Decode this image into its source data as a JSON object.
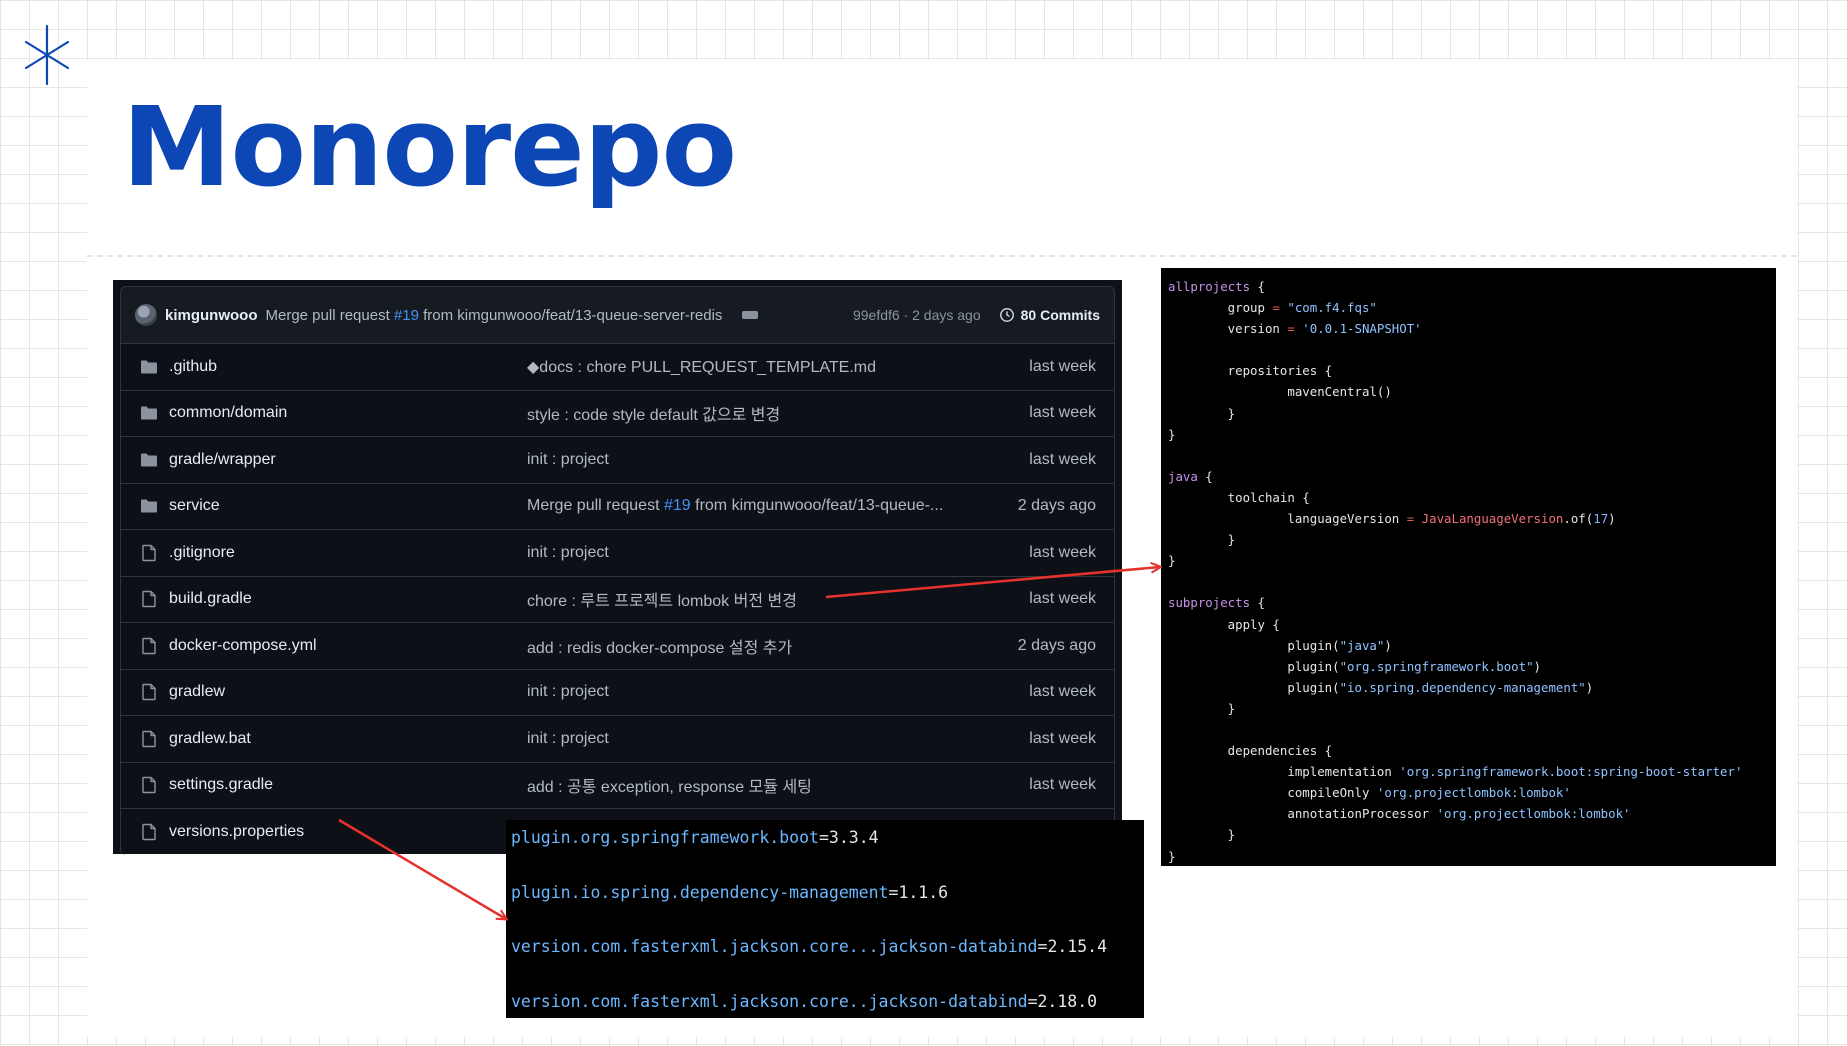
{
  "slide": {
    "title": "Monorepo"
  },
  "repo": {
    "latest_commit": {
      "author": "kimgunwooo",
      "message_prefix": "Merge pull request",
      "pr": "#19",
      "message_suffix": "from kimgunwooo/feat/13-queue-server-redis",
      "sha_time": "99efdf6 · 2 days ago",
      "commits": "80 Commits"
    },
    "files": [
      {
        "type": "folder",
        "name": ".github",
        "message": "◆docs : chore PULL_REQUEST_TEMPLATE.md",
        "age": "last week"
      },
      {
        "type": "folder",
        "name": "common/domain",
        "message": "style : code style default 값으로 변경",
        "age": "last week"
      },
      {
        "type": "folder",
        "name": "gradle/wrapper",
        "message": "init : project",
        "age": "last week"
      },
      {
        "type": "folder",
        "name": "service",
        "message_prefix": "Merge pull request",
        "pr": "#19",
        "message_suffix": "from kimgunwooo/feat/13-queue-...",
        "age": "2 days ago"
      },
      {
        "type": "file",
        "name": ".gitignore",
        "message": "init : project",
        "age": "last week"
      },
      {
        "type": "file",
        "name": "build.gradle",
        "message": "chore : 루트 프로젝트 lombok 버전 변경",
        "age": "last week"
      },
      {
        "type": "file",
        "name": "docker-compose.yml",
        "message": "add : redis docker-compose 설정 추가",
        "age": "2 days ago"
      },
      {
        "type": "file",
        "name": "gradlew",
        "message": "init : project",
        "age": "last week"
      },
      {
        "type": "file",
        "name": "gradlew.bat",
        "message": "init : project",
        "age": "last week"
      },
      {
        "type": "file",
        "name": "settings.gradle",
        "message": "add : 공통 exception, response 모듈 세팅",
        "age": "last week"
      },
      {
        "type": "file",
        "name": "versions.properties",
        "message": "",
        "age": ""
      }
    ]
  },
  "gradle": {
    "lines": [
      {
        "parts": [
          [
            "kw",
            "allprojects"
          ],
          [
            "txt",
            " {"
          ]
        ]
      },
      {
        "parts": [
          [
            "txt",
            "        group "
          ],
          [
            "op",
            "="
          ],
          [
            "str",
            " \"com.f4.fqs\""
          ]
        ]
      },
      {
        "parts": [
          [
            "txt",
            "        version "
          ],
          [
            "op",
            "="
          ],
          [
            "str",
            " '0.0.1-SNAPSHOT'"
          ]
        ]
      },
      {
        "parts": [
          [
            "txt",
            ""
          ]
        ]
      },
      {
        "parts": [
          [
            "txt",
            "        repositories {"
          ]
        ]
      },
      {
        "parts": [
          [
            "txt",
            "                mavenCentral()"
          ]
        ]
      },
      {
        "parts": [
          [
            "txt",
            "        }"
          ]
        ]
      },
      {
        "parts": [
          [
            "txt",
            "}"
          ]
        ]
      },
      {
        "parts": [
          [
            "txt",
            ""
          ]
        ]
      },
      {
        "parts": [
          [
            "kw",
            "java"
          ],
          [
            "txt",
            " {"
          ]
        ]
      },
      {
        "parts": [
          [
            "txt",
            "        toolchain {"
          ]
        ]
      },
      {
        "parts": [
          [
            "txt",
            "                languageVersion "
          ],
          [
            "op",
            "="
          ],
          [
            "cls",
            " JavaLanguageVersion"
          ],
          [
            "txt",
            ".of("
          ],
          [
            "num",
            "17"
          ],
          [
            "txt",
            ")"
          ]
        ]
      },
      {
        "parts": [
          [
            "txt",
            "        }"
          ]
        ]
      },
      {
        "parts": [
          [
            "txt",
            "}"
          ]
        ]
      },
      {
        "parts": [
          [
            "txt",
            ""
          ]
        ]
      },
      {
        "parts": [
          [
            "kw",
            "subprojects"
          ],
          [
            "txt",
            " {"
          ]
        ]
      },
      {
        "parts": [
          [
            "txt",
            "        apply {"
          ]
        ]
      },
      {
        "parts": [
          [
            "txt",
            "                plugin("
          ],
          [
            "str",
            "\"java\""
          ],
          [
            "txt",
            ")"
          ]
        ]
      },
      {
        "parts": [
          [
            "txt",
            "                plugin("
          ],
          [
            "str",
            "\"org.springframework.boot\""
          ],
          [
            "txt",
            ")"
          ]
        ]
      },
      {
        "parts": [
          [
            "txt",
            "                plugin("
          ],
          [
            "str",
            "\"io.spring.dependency-management\""
          ],
          [
            "txt",
            ")"
          ]
        ]
      },
      {
        "parts": [
          [
            "txt",
            "        }"
          ]
        ]
      },
      {
        "parts": [
          [
            "txt",
            ""
          ]
        ]
      },
      {
        "parts": [
          [
            "txt",
            "        dependencies {"
          ]
        ]
      },
      {
        "parts": [
          [
            "txt",
            "                implementation "
          ],
          [
            "str",
            "'org.springframework.boot:spring-boot-starter'"
          ]
        ]
      },
      {
        "parts": [
          [
            "txt",
            "                compileOnly "
          ],
          [
            "str",
            "'org.projectlombok:lombok'"
          ]
        ]
      },
      {
        "parts": [
          [
            "txt",
            "                annotationProcessor "
          ],
          [
            "str",
            "'org.projectlombok:lombok'"
          ]
        ]
      },
      {
        "parts": [
          [
            "txt",
            "        }"
          ]
        ]
      },
      {
        "parts": [
          [
            "txt",
            "}"
          ]
        ]
      }
    ]
  },
  "versions": [
    {
      "key": "plugin.org.springframework.boot",
      "value": "3.3.4"
    },
    {
      "key": "plugin.io.spring.dependency-management",
      "value": "1.1.6"
    },
    {
      "key": "version.com.fasterxml.jackson.core...jackson-databind",
      "value": "2.15.4"
    },
    {
      "key": "version.com.fasterxml.jackson.core..jackson-databind",
      "value": "2.18.0"
    }
  ],
  "colors": {
    "title": "#0d47b5",
    "arrow": "#e5322d"
  }
}
